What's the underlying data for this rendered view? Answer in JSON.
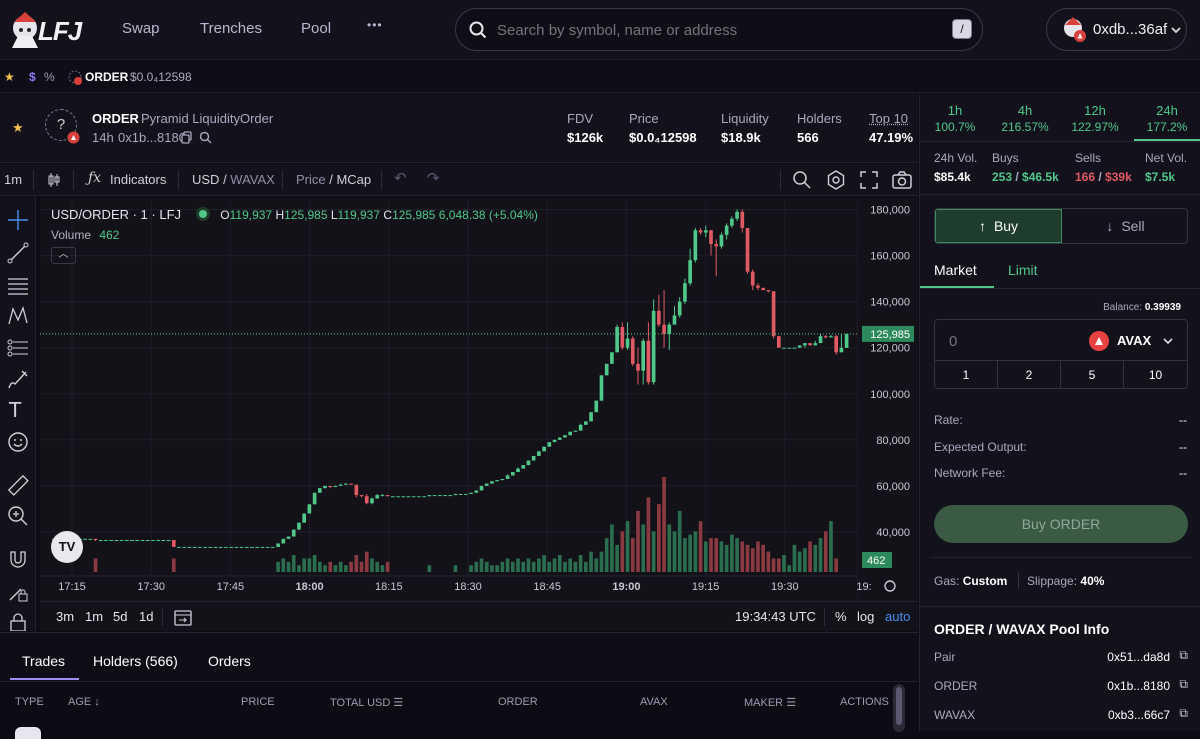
{
  "nav": {
    "logo": "LFJ",
    "links": [
      "Swap",
      "Trenches",
      "Pool"
    ],
    "more": "•••",
    "search_placeholder": "Search by symbol, name or address",
    "search_shortcut": "/",
    "wallet": "0xdb...36af"
  },
  "favbar": {
    "dollar": "$",
    "percent": "%",
    "token": "ORDER",
    "price": "$0.0₄12598"
  },
  "token": {
    "symbol": "ORDER",
    "name": "Pyramid LiquidityOrder",
    "age": "14h",
    "address": "0x1b...8180",
    "stats": [
      {
        "label": "FDV",
        "value": "$126k"
      },
      {
        "label": "Price",
        "value": "$0.0₄12598"
      },
      {
        "label": "Liquidity",
        "value": "$18.9k"
      },
      {
        "label": "Holders",
        "value": "566"
      },
      {
        "label": "Top 10",
        "value": "47.19%"
      }
    ]
  },
  "toolbar": {
    "interval": "1m",
    "indicators": "Indicators",
    "currency_usd": "USD",
    "currency_sep": " / ",
    "currency_wavax": "WAVAX",
    "mode_price": "Price",
    "mode_sep": " / ",
    "mode_mcap": "MCap"
  },
  "chart_header": {
    "pair": "USD/ORDER · 1 · LFJ",
    "o_label": "O",
    "o": "119,937",
    "h_label": "H",
    "h": "125,985",
    "l_label": "L",
    "l": "119,937",
    "c_label": "C",
    "c": "125,985",
    "change": "6,048.38 (+5.04%)",
    "volume_label": "Volume",
    "volume": "462"
  },
  "chart_data": {
    "type": "candlestick",
    "x_ticks": [
      "17:15",
      "17:30",
      "17:45",
      "18:00",
      "18:15",
      "18:30",
      "18:45",
      "19:00",
      "19:15",
      "19:30",
      "19:"
    ],
    "y_ticks": [
      "180,000",
      "160,000",
      "140,000",
      "120,000",
      "100,000",
      "80,000",
      "60,000",
      "40,000"
    ],
    "ylim": [
      20000,
      185000
    ],
    "last_price_label": "125,985",
    "last_volume_label": "462",
    "candles": [
      [
        37000,
        37000,
        37000,
        37000
      ],
      [
        37000,
        37000,
        37000,
        37000
      ],
      [
        37000,
        37000,
        37000,
        37000
      ],
      [
        37000,
        37000,
        37000,
        37000
      ],
      [
        37000,
        37000,
        37000,
        37000
      ],
      [
        37000,
        37000,
        37000,
        37000
      ],
      [
        37000,
        37000,
        37000,
        37000
      ],
      [
        37000,
        37000,
        37000,
        37000
      ],
      [
        37000,
        37000,
        36000,
        36500
      ],
      [
        36500,
        36500,
        36500,
        36500
      ],
      [
        36500,
        36500,
        36500,
        36500
      ],
      [
        36500,
        36500,
        36500,
        36500
      ],
      [
        36500,
        36500,
        36500,
        36500
      ],
      [
        36500,
        36500,
        36500,
        36500
      ],
      [
        36500,
        36500,
        36500,
        36500
      ],
      [
        36500,
        36500,
        36500,
        36500
      ],
      [
        36500,
        36500,
        36500,
        36500
      ],
      [
        36500,
        36500,
        36500,
        36500
      ],
      [
        36500,
        36500,
        36500,
        36500
      ],
      [
        36500,
        36500,
        36500,
        36500
      ],
      [
        36500,
        36500,
        36500,
        36500
      ],
      [
        36500,
        36500,
        36500,
        36500
      ],
      [
        36500,
        36500,
        36500,
        36500
      ],
      [
        36500,
        36500,
        33500,
        33500
      ],
      [
        33500,
        33500,
        33500,
        33500
      ],
      [
        33500,
        33500,
        33500,
        33500
      ],
      [
        33500,
        33500,
        33500,
        33500
      ],
      [
        33500,
        33500,
        33500,
        33500
      ],
      [
        33500,
        33500,
        33500,
        33500
      ],
      [
        33500,
        33500,
        33500,
        33500
      ],
      [
        33500,
        33500,
        33500,
        33500
      ],
      [
        33500,
        33500,
        33500,
        33500
      ],
      [
        33500,
        33500,
        33500,
        33500
      ],
      [
        33500,
        33500,
        33500,
        33500
      ],
      [
        33500,
        33500,
        33500,
        33500
      ],
      [
        33500,
        33500,
        33500,
        33500
      ],
      [
        33500,
        33500,
        33500,
        33500
      ],
      [
        33500,
        33500,
        33500,
        33500
      ],
      [
        33500,
        33500,
        33500,
        33500
      ],
      [
        33500,
        33500,
        33500,
        33500
      ],
      [
        33500,
        33500,
        33500,
        33500
      ],
      [
        33500,
        33500,
        33500,
        33500
      ],
      [
        33500,
        33500,
        33500,
        33500
      ],
      [
        33500,
        35000,
        33500,
        35000
      ],
      [
        35000,
        37000,
        35000,
        37000
      ],
      [
        37000,
        38000,
        37000,
        38000
      ],
      [
        38000,
        41000,
        38000,
        41000
      ],
      [
        41000,
        44000,
        41000,
        44000
      ],
      [
        44000,
        48000,
        44000,
        48000
      ],
      [
        48000,
        52000,
        48000,
        52000
      ],
      [
        52000,
        57000,
        52000,
        57000
      ],
      [
        57000,
        59000,
        57000,
        59000
      ],
      [
        59000,
        60000,
        59000,
        60000
      ],
      [
        60000,
        60000,
        59000,
        59500
      ],
      [
        59500,
        60000,
        59500,
        60000
      ],
      [
        60000,
        61000,
        60000,
        60500
      ],
      [
        60500,
        61000,
        60500,
        61000
      ],
      [
        61000,
        61000,
        60500,
        60500
      ],
      [
        60500,
        60500,
        55000,
        56000
      ],
      [
        56000,
        56000,
        55000,
        55500
      ],
      [
        55500,
        56500,
        52000,
        52500
      ],
      [
        52500,
        55000,
        52000,
        54500
      ],
      [
        54500,
        56500,
        54500,
        56000
      ],
      [
        56000,
        56500,
        55500,
        56000
      ],
      [
        56000,
        56000,
        55500,
        55500
      ],
      [
        55500,
        55500,
        55500,
        55500
      ],
      [
        55500,
        55500,
        55500,
        55500
      ],
      [
        55500,
        55500,
        55500,
        55500
      ],
      [
        55500,
        55500,
        55500,
        55500
      ],
      [
        55500,
        55500,
        55500,
        55500
      ],
      [
        55500,
        55500,
        55500,
        55500
      ],
      [
        55500,
        55500,
        55500,
        55500
      ],
      [
        55500,
        56000,
        55500,
        56000
      ],
      [
        56000,
        56000,
        56000,
        56000
      ],
      [
        56000,
        56000,
        56000,
        56000
      ],
      [
        56000,
        56000,
        56000,
        56000
      ],
      [
        56000,
        56000,
        56000,
        56000
      ],
      [
        56000,
        56500,
        56000,
        56500
      ],
      [
        56500,
        56500,
        56500,
        56500
      ],
      [
        56500,
        56500,
        56500,
        56500
      ],
      [
        56500,
        57000,
        56500,
        57000
      ],
      [
        57000,
        58000,
        57000,
        58000
      ],
      [
        58000,
        60000,
        58000,
        60000
      ],
      [
        60000,
        61000,
        60000,
        61000
      ],
      [
        61000,
        62000,
        61000,
        62000
      ],
      [
        62000,
        62500,
        62000,
        62500
      ],
      [
        62500,
        63000,
        62500,
        63000
      ],
      [
        63000,
        65000,
        63000,
        64500
      ],
      [
        64500,
        66000,
        64500,
        66000
      ],
      [
        66000,
        68000,
        66000,
        67500
      ],
      [
        67500,
        69000,
        67500,
        69000
      ],
      [
        69000,
        71000,
        69000,
        71000
      ],
      [
        71000,
        73000,
        71000,
        73000
      ],
      [
        73000,
        75000,
        73000,
        75000
      ],
      [
        75000,
        77000,
        75000,
        77000
      ],
      [
        77000,
        79000,
        77000,
        79000
      ],
      [
        79000,
        80000,
        79000,
        80000
      ],
      [
        80000,
        81000,
        80000,
        81000
      ],
      [
        81000,
        82000,
        81000,
        82000
      ],
      [
        82000,
        83500,
        82000,
        83500
      ],
      [
        83500,
        84000,
        83500,
        84000
      ],
      [
        84000,
        87000,
        84000,
        86500
      ],
      [
        86500,
        88000,
        86500,
        88000
      ],
      [
        88000,
        92000,
        88000,
        92000
      ],
      [
        92000,
        97000,
        92000,
        97000
      ],
      [
        97000,
        108000,
        97000,
        108000
      ],
      [
        108000,
        113000,
        108000,
        113000
      ],
      [
        113000,
        118000,
        113000,
        118000
      ],
      [
        118000,
        130000,
        118000,
        129000
      ],
      [
        129000,
        131000,
        119000,
        120000
      ],
      [
        120000,
        131000,
        119000,
        124000
      ],
      [
        124000,
        125000,
        112000,
        113000
      ],
      [
        113000,
        120000,
        104000,
        110000
      ],
      [
        110000,
        124000,
        104000,
        123000
      ],
      [
        123000,
        131000,
        104000,
        105000
      ],
      [
        105000,
        141000,
        104000,
        136000
      ],
      [
        136000,
        143000,
        129000,
        130000
      ],
      [
        130000,
        145000,
        120000,
        126000
      ],
      [
        126000,
        131000,
        119000,
        130000
      ],
      [
        130000,
        138000,
        130000,
        134000
      ],
      [
        134000,
        142000,
        133000,
        140000
      ],
      [
        140000,
        150000,
        139000,
        148000
      ],
      [
        148000,
        163000,
        147000,
        158000
      ],
      [
        158000,
        172000,
        157000,
        171000
      ],
      [
        171000,
        172000,
        169000,
        170000
      ],
      [
        170000,
        173000,
        168000,
        171000
      ],
      [
        171000,
        171000,
        160000,
        165000
      ],
      [
        165000,
        167000,
        151000,
        164000
      ],
      [
        164000,
        170000,
        163000,
        169000
      ],
      [
        169000,
        174000,
        167000,
        173000
      ],
      [
        173000,
        177000,
        172000,
        176000
      ],
      [
        176000,
        180000,
        175000,
        179000
      ],
      [
        179000,
        180000,
        170000,
        172000
      ],
      [
        172000,
        172000,
        152000,
        153000
      ],
      [
        153000,
        154000,
        145000,
        147000
      ],
      [
        147000,
        148000,
        145000,
        146000
      ],
      [
        146000,
        146000,
        145000,
        145000
      ],
      [
        145000,
        145000,
        144000,
        144500
      ],
      [
        144500,
        144500,
        124000,
        125000
      ],
      [
        125000,
        125000,
        120000,
        120000
      ],
      [
        120000,
        120000,
        120000,
        120000
      ],
      [
        120000,
        120000,
        120000,
        120000
      ],
      [
        120000,
        120000,
        120000,
        120000
      ],
      [
        120000,
        121000,
        120000,
        121000
      ],
      [
        121000,
        122000,
        120000,
        122000
      ],
      [
        122000,
        122000,
        121000,
        121000
      ],
      [
        121000,
        123000,
        121000,
        122000
      ],
      [
        122000,
        126000,
        122000,
        125000
      ],
      [
        125000,
        125500,
        124000,
        124500
      ],
      [
        124500,
        125500,
        124500,
        125000
      ],
      [
        125000,
        125500,
        117000,
        118000
      ],
      [
        118000,
        126000,
        118000,
        119937
      ],
      [
        119937,
        125985,
        119937,
        125985
      ]
    ],
    "volumes": [
      0,
      0,
      0,
      0,
      0,
      0,
      0,
      0,
      4,
      0,
      0,
      0,
      0,
      0,
      0,
      0,
      0,
      0,
      0,
      0,
      0,
      0,
      0,
      4,
      0,
      0,
      0,
      0,
      0,
      0,
      0,
      0,
      0,
      0,
      0,
      0,
      0,
      0,
      0,
      0,
      0,
      0,
      0,
      3,
      4,
      3,
      5,
      2,
      4,
      4,
      5,
      3,
      2,
      3,
      2,
      3,
      2,
      3,
      5,
      3,
      6,
      4,
      3,
      2,
      3,
      0,
      0,
      0,
      0,
      0,
      0,
      0,
      2,
      0,
      0,
      0,
      0,
      2,
      0,
      0,
      2,
      3,
      4,
      3,
      2,
      2,
      3,
      4,
      3,
      4,
      3,
      4,
      3,
      4,
      5,
      3,
      4,
      5,
      3,
      4,
      3,
      5,
      3,
      6,
      4,
      6,
      10,
      14,
      8,
      12,
      15,
      10,
      18,
      14,
      22,
      12,
      20,
      28,
      14,
      12,
      18,
      10,
      11,
      12,
      15,
      9,
      10,
      10,
      9,
      8,
      11,
      10,
      9,
      8,
      7,
      9,
      8,
      6,
      4,
      4,
      5,
      2,
      8,
      6,
      7,
      9,
      8,
      10,
      12,
      15,
      4
    ]
  },
  "chart_foot": {
    "ranges": [
      "3m",
      "1m",
      "5d",
      "1d"
    ],
    "time": "19:34:43 UTC",
    "pct": "%",
    "log": "log",
    "auto": "auto"
  },
  "bottom_tabs": [
    "Trades",
    "Holders (566)",
    "Orders"
  ],
  "table_headers": {
    "type": "TYPE",
    "age": "AGE",
    "price": "PRICE",
    "total_usd": "TOTAL USD",
    "order": "ORDER",
    "avax": "AVAX",
    "maker": "MAKER",
    "actions": "ACTIONS"
  },
  "tf_tabs": [
    {
      "label": "1h",
      "value": "100.7%"
    },
    {
      "label": "4h",
      "value": "216.57%"
    },
    {
      "label": "12h",
      "value": "122.97%"
    },
    {
      "label": "24h",
      "value": "177.2%"
    }
  ],
  "vol": {
    "vol_label": "24h Vol.",
    "vol_value": "$85.4k",
    "buys_label": "Buys",
    "buys_count": "253",
    "buys_value": "$46.5k",
    "sells_label": "Sells",
    "sells_count": "166",
    "sells_value": "$39k",
    "net_label": "Net Vol.",
    "net_value": "$7.5k",
    "slash": " / "
  },
  "trade": {
    "buy": "Buy",
    "sell": "Sell",
    "market": "Market",
    "limit": "Limit",
    "balance_label": "Balance:",
    "balance": "0.39939",
    "amount_placeholder": "0",
    "asset": "AVAX",
    "quick": [
      "1",
      "2",
      "5",
      "10"
    ],
    "rate_label": "Rate:",
    "rate": "--",
    "output_label": "Expected Output:",
    "output": "--",
    "fee_label": "Network Fee:",
    "fee": "--",
    "submit": "Buy ORDER",
    "gas_label": "Gas:",
    "gas": "Custom",
    "slip_label": "Slippage:",
    "slip": "40%"
  },
  "pool": {
    "title": "ORDER / WAVAX Pool Info",
    "rows": [
      {
        "label": "Pair",
        "value": "0x51...da8d"
      },
      {
        "label": "ORDER",
        "value": "0x1b...8180"
      },
      {
        "label": "WAVAX",
        "value": "0xb3...66c7"
      }
    ]
  },
  "colors": {
    "up": "#4fc88a",
    "down": "#e05a64",
    "accent": "#2a6e45"
  }
}
